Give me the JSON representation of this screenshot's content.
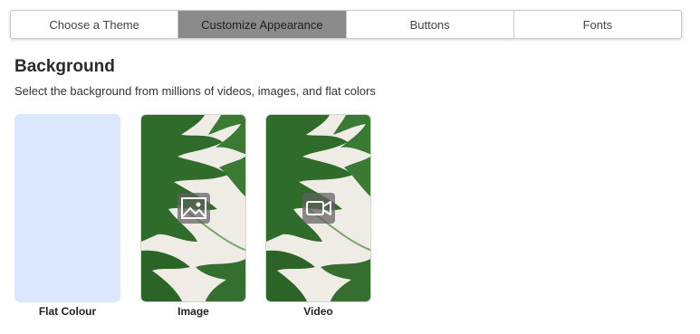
{
  "tabs": [
    {
      "label": "Choose a Theme",
      "active": false
    },
    {
      "label": "Customize Appearance",
      "active": true
    },
    {
      "label": "Buttons",
      "active": false
    },
    {
      "label": "Fonts",
      "active": false
    }
  ],
  "section": {
    "title": "Background",
    "subtitle": "Select the background from millions of videos, images, and flat colors"
  },
  "options": [
    {
      "label": "Flat Colour",
      "icon": "none",
      "swatch_color": "#dbe6ff"
    },
    {
      "label": "Image",
      "icon": "image-icon"
    },
    {
      "label": "Video",
      "icon": "video-camera-icon"
    }
  ],
  "colors": {
    "active_tab": "#8b8b8b",
    "leaf_green": "#2f6b2a",
    "leaf_background": "#efece6"
  }
}
